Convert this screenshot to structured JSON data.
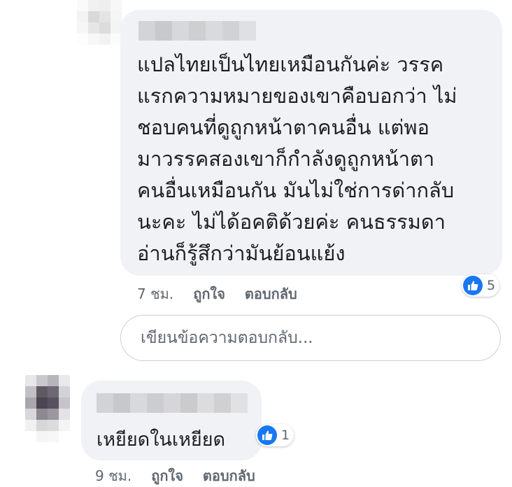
{
  "comment": {
    "text": "แปลไทยเป็นไทยเหมือนกันค่ะ วรรค\nแรกความหมายของเขาคือบอกว่า ไม่\nชอบคนที่ดูถูกหน้าตาคนอื่น แต่พอ\nมาวรรคสองเขาก็กำลังดูถูกหน้าตา\nคนอื่นเหมือนกัน มันไม่ใช่การด่ากลับ\nนะคะ ไม่ได้อคติด้วยค่ะ คนธรรมดา\nอ่านก็รู้สึกว่ามันย้อนแย้ง",
    "time": "7 ชม.",
    "like_label": "ถูกใจ",
    "reply_label": "ตอบกลับ",
    "reaction_count": "5",
    "reaction_icon": "like-icon",
    "reaction_color": "#1877f2"
  },
  "reply_box": {
    "placeholder": "เขียนข้อความตอบกลับ..."
  },
  "reply": {
    "text": "เหยียดในเหยียด",
    "time": "9 ชม.",
    "like_label": "ถูกใจ",
    "reply_label": "ตอบกลับ",
    "reaction_count": "1",
    "reaction_icon": "like-icon"
  },
  "colors": {
    "bubble": "#f0f2f5",
    "meta_text": "#606770",
    "like_blue": "#1877f2"
  }
}
